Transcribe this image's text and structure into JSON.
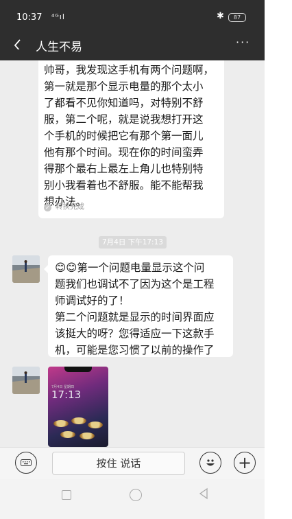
{
  "status_bar": {
    "time": "10:37",
    "signal": "⁴ᴳıl",
    "bluetooth": "✱",
    "battery": "87"
  },
  "header": {
    "back_icon": "chevron-left-icon",
    "title": "人生不易",
    "more": "···"
  },
  "messages": [
    {
      "side": "right-user",
      "text": "帅哥，我发现这手机有两个问题啊，第一就是那个显示电量的那个太小了都看不见你知道吗，对特别不舒服，第二个呢，就是说我想打开这个手机的时候把它有那个第一面儿他有那个时间。现在你的时间蛮弄得那个最右上最左上角儿也特别特别小我看着也不舒服。能不能帮我想办法。",
      "lines": [
        "帅哥，我发现这手机有两个问题啊，",
        "第一就是那个显示电量的那个太小",
        "了都看不见你知道吗，对特别不舒",
        "服，第二个呢，就是说我想打开这",
        "个手机的时候把它有那个第一面儿",
        "他有那个时间。现在你的时间蛮弄",
        "得那个最右上最左上角儿也特别特",
        "别小我看着也不舒服。能不能帮我",
        "想办法。"
      ],
      "convert_status": "转换完成"
    }
  ],
  "timestamp": "7月4日 下午17:13",
  "reply": {
    "lines": [
      "😊😊第一个问题电量显示这个问",
      "题我们也调试不了因为这个是工程",
      "师调试好的了！",
      "第二个问题就是显示的时间界面应",
      "该挺大的呀？您得适应一下这款手",
      "机，可能是您习惯了以前的操作了"
    ]
  },
  "photo": {
    "time": "17:13",
    "sub": "7月4日 星期四"
  },
  "input_bar": {
    "hold_to_talk": "按住 说话",
    "plus": "+"
  },
  "colors": {
    "header_bg": "#2e2e2e",
    "chat_bg": "#ededed",
    "bubble_bg": "#ffffff"
  }
}
